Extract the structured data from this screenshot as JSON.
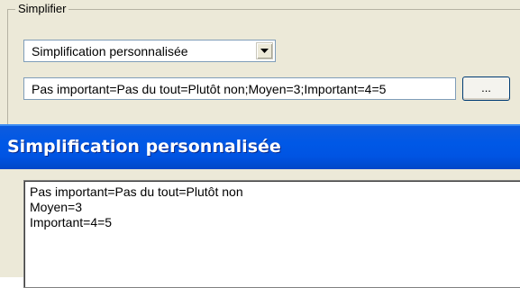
{
  "group": {
    "legend": "Simplifier"
  },
  "combo": {
    "value": "Simplification personnalisée"
  },
  "input": {
    "value": "Pas important=Pas du tout=Plutôt non;Moyen=3;Important=4=5"
  },
  "ellipsis_button": {
    "label": "..."
  },
  "dialog": {
    "title": "Simplification personnalisée",
    "lines": [
      "Pas important=Pas du tout=Plutôt non",
      "Moyen=3",
      "Important=4=5"
    ]
  },
  "colors": {
    "titlebar": "#0054e3",
    "panel": "#ece9d8",
    "input_border": "#7f9db9"
  },
  "icons": {
    "combo_arrow": "chevron-down-icon"
  }
}
